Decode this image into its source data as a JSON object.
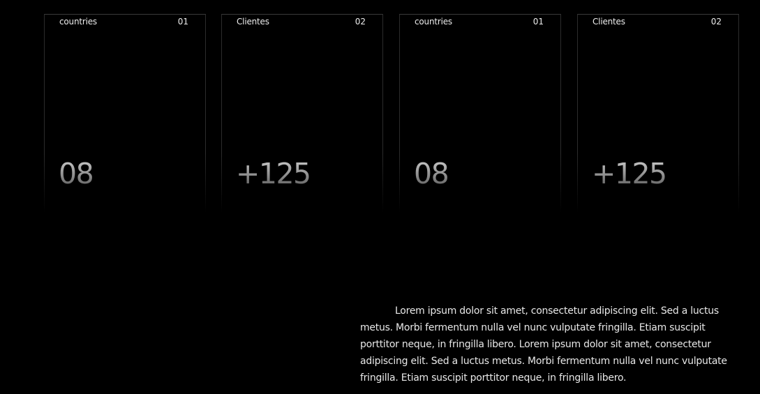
{
  "stats": [
    {
      "label": "countries",
      "index": "01",
      "value": "08"
    },
    {
      "label": "Clientes",
      "index": "02",
      "value": "+125"
    },
    {
      "label": "countries",
      "index": "01",
      "value": "08"
    },
    {
      "label": "Clientes",
      "index": "02",
      "value": "+125"
    }
  ],
  "description": "Lorem ipsum dolor sit amet, consectetur adipiscing elit. Sed a luctus metus. Morbi fermentum nulla vel nunc vulputate fringilla. Etiam suscipit porttitor neque, in fringilla libero. Lorem ipsum dolor sit amet, consectetur adipiscing elit. Sed a luctus metus. Morbi fermentum nulla vel nunc vulputate fringilla. Etiam suscipit porttitor neque, in fringilla libero.",
  "colors": {
    "background": "#000000",
    "text": "#e6e6e6",
    "border": "#2c2c2c"
  }
}
